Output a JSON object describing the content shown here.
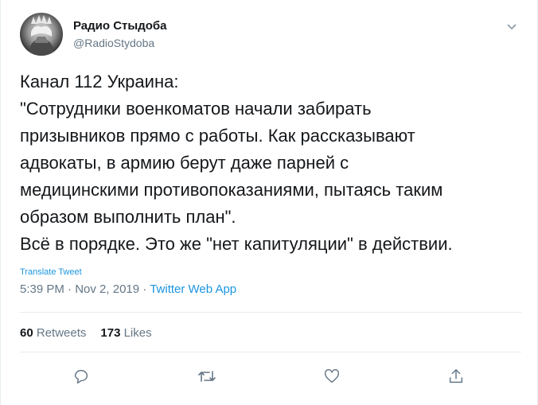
{
  "user": {
    "display_name": "Радио Стыдоба",
    "handle": "@RadioStydoba",
    "avatar_icon": "statue-of-liberty-facepalm-avatar"
  },
  "tweet": {
    "lines": [
      "Канал 112 Украина:",
      "\"Сотрудники военкоматов начали забирать",
      "призывников прямо с работы. Как рассказывают",
      "адвокаты, в армию берут даже парней с",
      "медицинскими противопоказаниями, пытаясь таким",
      "образом выполнить план\".",
      "Всё в порядке. Это же \"нет капитуляции\" в действии."
    ],
    "translate_label": "Translate Tweet",
    "time": "5:39 PM",
    "date": "Nov 2, 2019",
    "separator": "·",
    "source": "Twitter Web App"
  },
  "stats": {
    "retweets_count": "60",
    "retweets_label": "Retweets",
    "likes_count": "173",
    "likes_label": "Likes"
  },
  "actions": {
    "reply_icon": "reply-icon",
    "retweet_icon": "retweet-icon",
    "like_icon": "heart-icon",
    "share_icon": "share-icon"
  },
  "colors": {
    "text": "#14171a",
    "secondary": "#657786",
    "link": "#1b95e0",
    "divider": "#e6ecf0"
  }
}
